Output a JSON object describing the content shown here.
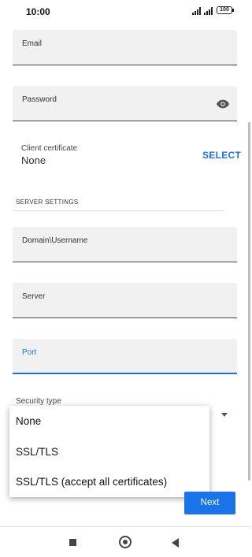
{
  "status_bar": {
    "time": "10:00",
    "battery": "100"
  },
  "form": {
    "email_label": "Email",
    "password_label": "Password",
    "client_cert_label": "Client certificate",
    "client_cert_value": "None",
    "select_label": "SELECT",
    "server_settings_title": "SERVER SETTINGS",
    "domain_user_label": "Domain\\Username",
    "server_label": "Server",
    "port_label": "Port",
    "security_type_label": "Security type"
  },
  "security_menu": {
    "options": [
      "None",
      "SSL/TLS",
      "SSL/TLS (accept all certificates)"
    ]
  },
  "actions": {
    "next_label": "Next"
  },
  "colors": {
    "accent": "#1a73e8",
    "field_bg": "#f1f1f1"
  },
  "icons": [
    "eye-icon",
    "square-nav-icon",
    "home-nav-icon",
    "back-nav-icon"
  ]
}
